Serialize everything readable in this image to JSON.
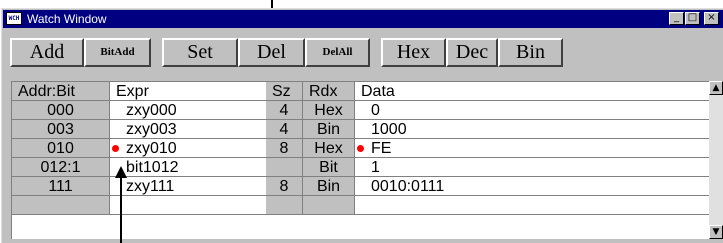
{
  "window": {
    "title": "Watch Window",
    "app_icon_text": "WCH"
  },
  "toolbar": {
    "buttons": [
      "Add",
      "BitAdd",
      "Set",
      "Del",
      "DelAll",
      "Hex",
      "Dec",
      "Bin"
    ]
  },
  "table": {
    "headers": {
      "addr": "Addr:Bit",
      "expr": "Expr",
      "sz": "Sz",
      "rdx": "Rdx",
      "data": "Data"
    },
    "rows": [
      {
        "addr": "000",
        "expr": "zxy000",
        "sz": "4",
        "rdx": "Hex",
        "data": "0",
        "marker_expr": false,
        "marker_data": false
      },
      {
        "addr": "003",
        "expr": "zxy003",
        "sz": "4",
        "rdx": "Bin",
        "data": "1000",
        "marker_expr": false,
        "marker_data": false
      },
      {
        "addr": "010",
        "expr": "zxy010",
        "sz": "8",
        "rdx": "Hex",
        "data": "FE",
        "marker_expr": true,
        "marker_data": true
      },
      {
        "addr": "012:1",
        "expr": "bit1012",
        "sz": "",
        "rdx": "Bit",
        "data": "1",
        "marker_expr": false,
        "marker_data": false
      },
      {
        "addr": "111",
        "expr": "zxy111",
        "sz": "8",
        "rdx": "Bin",
        "data": "0010:0111",
        "marker_expr": false,
        "marker_data": false
      },
      {
        "addr": "",
        "expr": "",
        "sz": "",
        "rdx": "",
        "data": "",
        "marker_expr": false,
        "marker_data": false
      }
    ]
  },
  "window_buttons": [
    "minimize",
    "maximize",
    "close"
  ],
  "colors": {
    "title_bar": "#000080",
    "marker": "#ff0000",
    "face": "#c0c0c0"
  }
}
